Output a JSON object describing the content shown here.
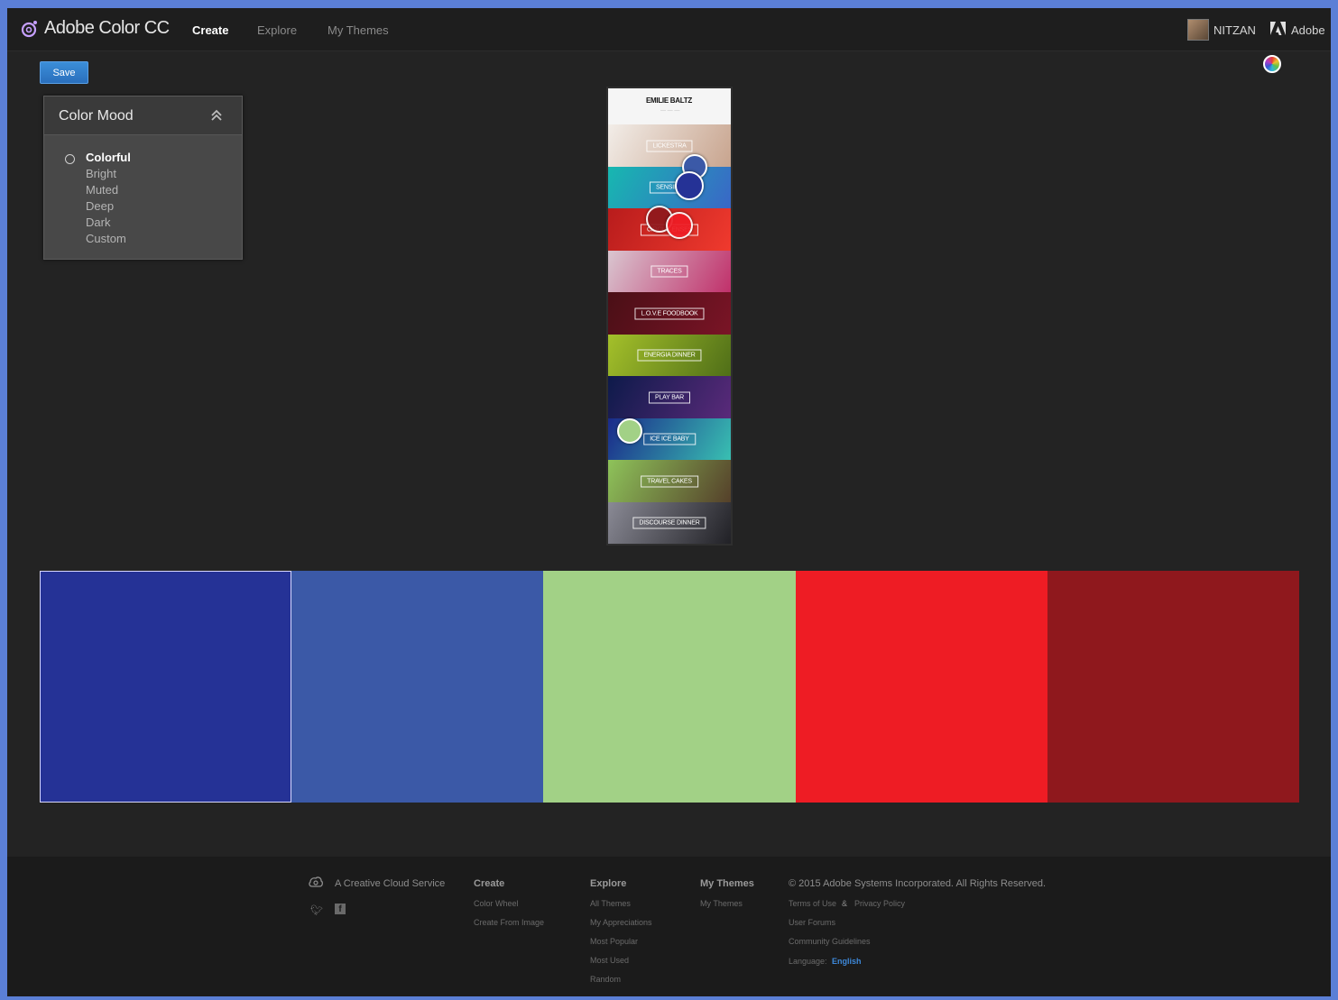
{
  "header": {
    "app_title": "Adobe Color CC",
    "logo_icon": "adobe-color-logo-icon",
    "nav": [
      "Create",
      "Explore",
      "My Themes"
    ],
    "active_nav": "Create",
    "username": "NITZAN",
    "adobe_label": "Adobe"
  },
  "toolbar": {
    "save_label": "Save",
    "color_wheel_icon": "color-wheel-icon"
  },
  "color_mood": {
    "title": "Color Mood",
    "options": [
      "Colorful",
      "Bright",
      "Muted",
      "Deep",
      "Dark",
      "Custom"
    ],
    "selected": "Colorful"
  },
  "image": {
    "header_title": "EMILIE BALTZ",
    "bands": [
      {
        "label": "LICKESTRA",
        "colors": [
          "#f2ede8",
          "#c8a48e"
        ]
      },
      {
        "label": "SENSING",
        "colors": [
          "#17b8b0",
          "#3a66c7"
        ]
      },
      {
        "label": "CIRCUS ENSES",
        "colors": [
          "#b81c1c",
          "#f03a2e"
        ]
      },
      {
        "label": "TRACES",
        "colors": [
          "#d9c6d0",
          "#c0306a"
        ]
      },
      {
        "label": "L.O.V.E FOODBOOK",
        "colors": [
          "#4a0f16",
          "#7a1426"
        ]
      },
      {
        "label": "ENERGIA DINNER",
        "colors": [
          "#a4c02a",
          "#4f6e18"
        ]
      },
      {
        "label": "PLAY BAR",
        "colors": [
          "#0d1a4a",
          "#5a2a7a"
        ]
      },
      {
        "label": "ICE ICE BABY",
        "colors": [
          "#1a2a8a",
          "#39c0b2"
        ]
      },
      {
        "label": "TRAVEL CAKES",
        "colors": [
          "#8ec35a",
          "#55402a"
        ]
      },
      {
        "label": "DISCOURSE DINNER",
        "colors": [
          "#8a8a95",
          "#202025"
        ]
      }
    ]
  },
  "theme": {
    "swatches": [
      "#253296",
      "#3b59a7",
      "#a2d186",
      "#ee1c24",
      "#8f181d"
    ],
    "selected_index": 0
  },
  "footer": {
    "cc_text": "A Creative Cloud Service",
    "columns": [
      {
        "head": "Create",
        "links": [
          "Color Wheel",
          "Create From Image"
        ]
      },
      {
        "head": "Explore",
        "links": [
          "All Themes",
          "My Appreciations",
          "Most Popular",
          "Most Used",
          "Random"
        ]
      },
      {
        "head": "My Themes",
        "links": [
          "My Themes"
        ]
      }
    ],
    "copyright": "© 2015 Adobe Systems Incorporated. All Rights Reserved.",
    "legal_links": [
      "Terms of Use",
      "Privacy Policy",
      "User Forums",
      "Community Guidelines"
    ],
    "amp": "&",
    "language_label": "Language:",
    "language_value": "English"
  }
}
